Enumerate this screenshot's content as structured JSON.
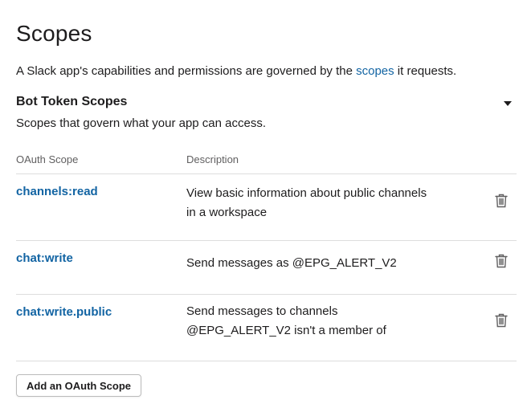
{
  "page": {
    "title": "Scopes",
    "intro_before": "A Slack app's capabilities and permissions are governed by the ",
    "intro_link": "scopes",
    "intro_after": " it requests."
  },
  "bot_token": {
    "title": "Bot Token Scopes",
    "subtitle": "Scopes that govern what your app can access.",
    "toggle_icon": "caret-down-icon"
  },
  "table": {
    "headers": {
      "scope": "OAuth Scope",
      "description": "Description"
    },
    "rows": [
      {
        "scope": "channels:read",
        "desc_line1": "View basic information about public channels",
        "desc_line2": "in a workspace",
        "icon": "trash-icon"
      },
      {
        "scope": "chat:write",
        "desc_line1": "Send messages as @EPG_ALERT_V2",
        "desc_line2": "",
        "icon": "trash-icon"
      },
      {
        "scope": "chat:write.public",
        "desc_line1": "Send messages to channels",
        "desc_line2": "@EPG_ALERT_V2 isn't a member of",
        "icon": "trash-icon"
      }
    ]
  },
  "actions": {
    "add_scope_label": "Add an OAuth Scope"
  },
  "colors": {
    "link": "#1264a3",
    "text": "#1d1c1d",
    "muted": "#616061",
    "divider": "#dddddd"
  }
}
